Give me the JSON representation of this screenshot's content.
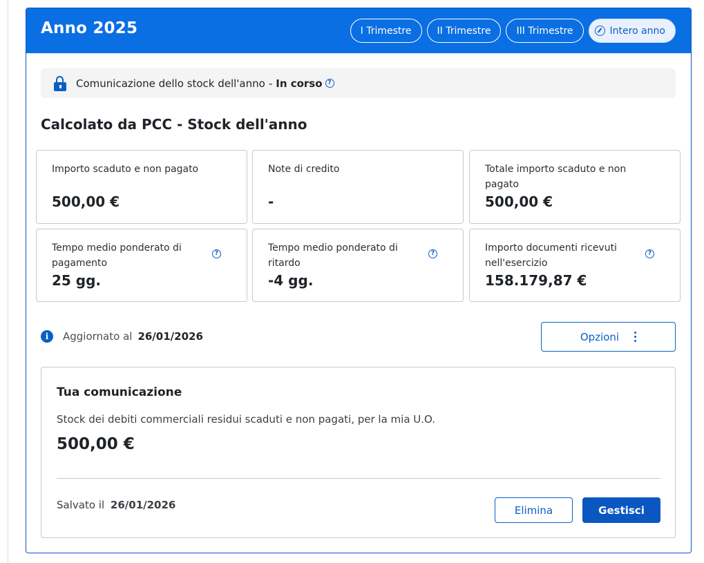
{
  "header": {
    "title": "Anno 2025",
    "tabs": [
      {
        "label": "I Trimestre",
        "active": false
      },
      {
        "label": "II Trimestre",
        "active": false
      },
      {
        "label": "III Trimestre",
        "active": false
      },
      {
        "label": "Intero anno",
        "active": true
      }
    ]
  },
  "status": {
    "icon": "lock-open-icon",
    "text": "Comunicazione dello stock dell'anno",
    "separator": "-",
    "state": "In corso"
  },
  "section": {
    "title": "Calcolato da PCC - Stock dell'anno"
  },
  "metrics": [
    {
      "label": "Importo scaduto e non pagato",
      "value": "500,00 €",
      "help": false
    },
    {
      "label": "Note di credito",
      "value": "-",
      "help": false
    },
    {
      "label": "Totale importo scaduto e non pagato",
      "value": "500,00 €",
      "help": false
    },
    {
      "label": "Tempo medio ponderato di pagamento",
      "value": "25 gg.",
      "help": true
    },
    {
      "label": "Tempo medio ponderato di ritardo",
      "value": "-4 gg.",
      "help": true
    },
    {
      "label": "Importo documenti ricevuti nell'esercizio",
      "value": "158.179,87 €",
      "help": true
    }
  ],
  "updated": {
    "label": "Aggiornato al",
    "date": "26/01/2026"
  },
  "options": {
    "label": "Opzioni"
  },
  "communication": {
    "title": "Tua comunicazione",
    "description": "Stock dei debiti commerciali residui scaduti e non pagati, per la mia U.O.",
    "value": "500,00 €",
    "saved_label": "Salvato il",
    "saved_date": "26/01/2026",
    "delete_label": "Elimina",
    "manage_label": "Gestisci"
  },
  "colors": {
    "header_bg": "#0a6fe3",
    "primary": "#0a5fc4",
    "border": "#c6c9cc",
    "status_bg": "#f4f4f4"
  }
}
